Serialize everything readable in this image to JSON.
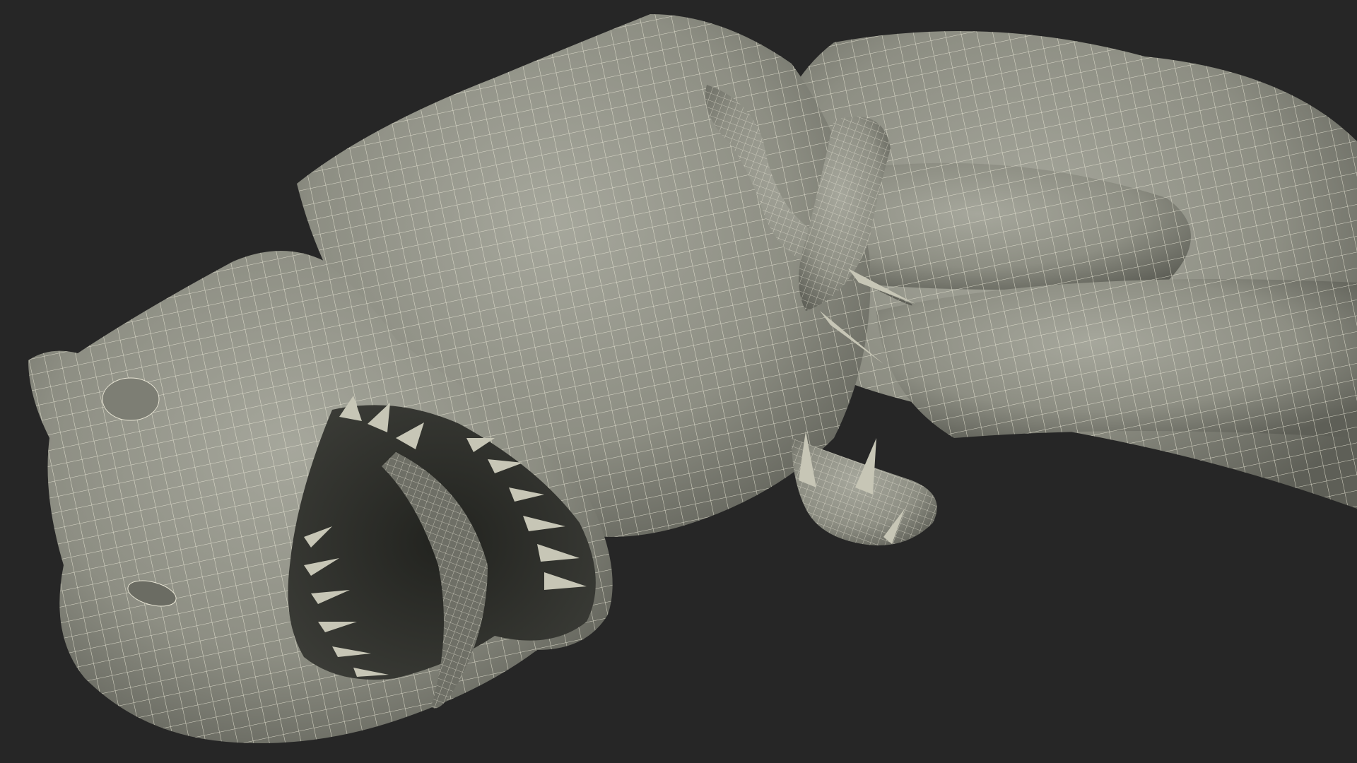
{
  "scene": {
    "background_color": "#262626",
    "surface_color": "#8d8e83",
    "surface_shadow_color": "#5e5f57",
    "surface_highlight_color": "#a6a79c",
    "wire_color": "#e9e6d6",
    "mouth_interior_color": "#2f302c",
    "tooth_color": "#c7c6b6"
  }
}
